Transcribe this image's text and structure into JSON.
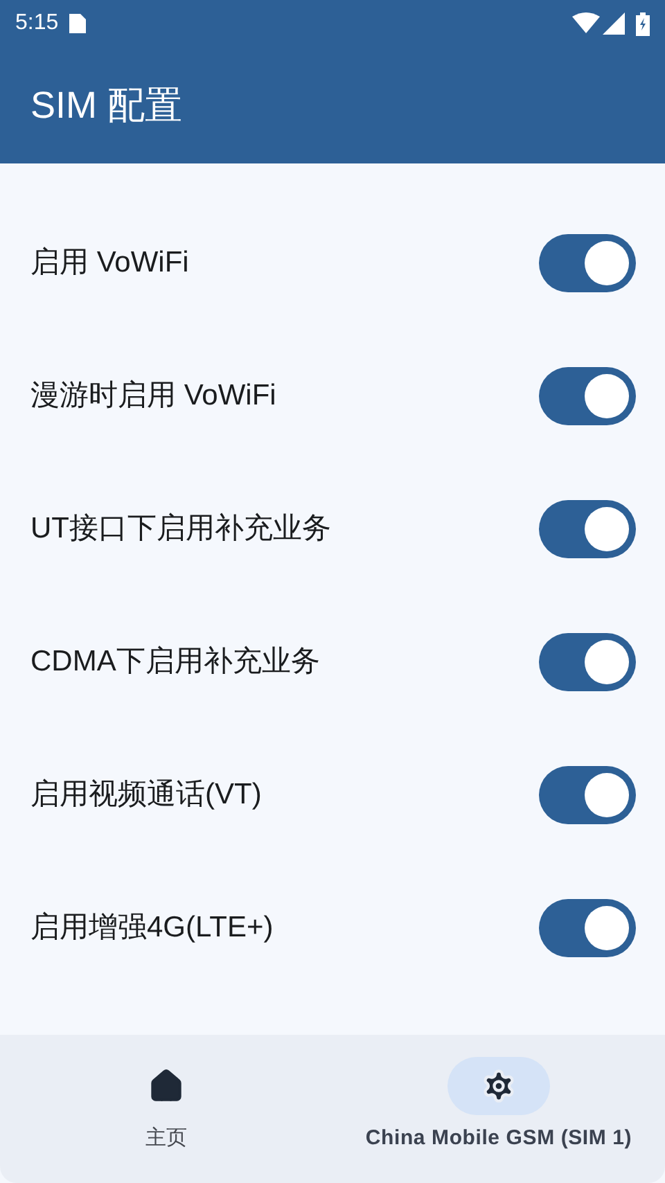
{
  "status_bar": {
    "time": "5:15"
  },
  "app_bar": {
    "title": "SIM 配置"
  },
  "settings": [
    {
      "label": "启用 VoWiFi",
      "on": true
    },
    {
      "label": "漫游时启用 VoWiFi",
      "on": true
    },
    {
      "label": "UT接口下启用补充业务",
      "on": true
    },
    {
      "label": "CDMA下启用补充业务",
      "on": true
    },
    {
      "label": "启用视频通话(VT)",
      "on": true
    },
    {
      "label": "启用增强4G(LTE+)",
      "on": true
    }
  ],
  "bottom_nav": [
    {
      "label": "主页",
      "kind": "home",
      "selected": false
    },
    {
      "label": "China Mobile GSM (SIM 1)",
      "kind": "settings",
      "selected": true
    }
  ]
}
